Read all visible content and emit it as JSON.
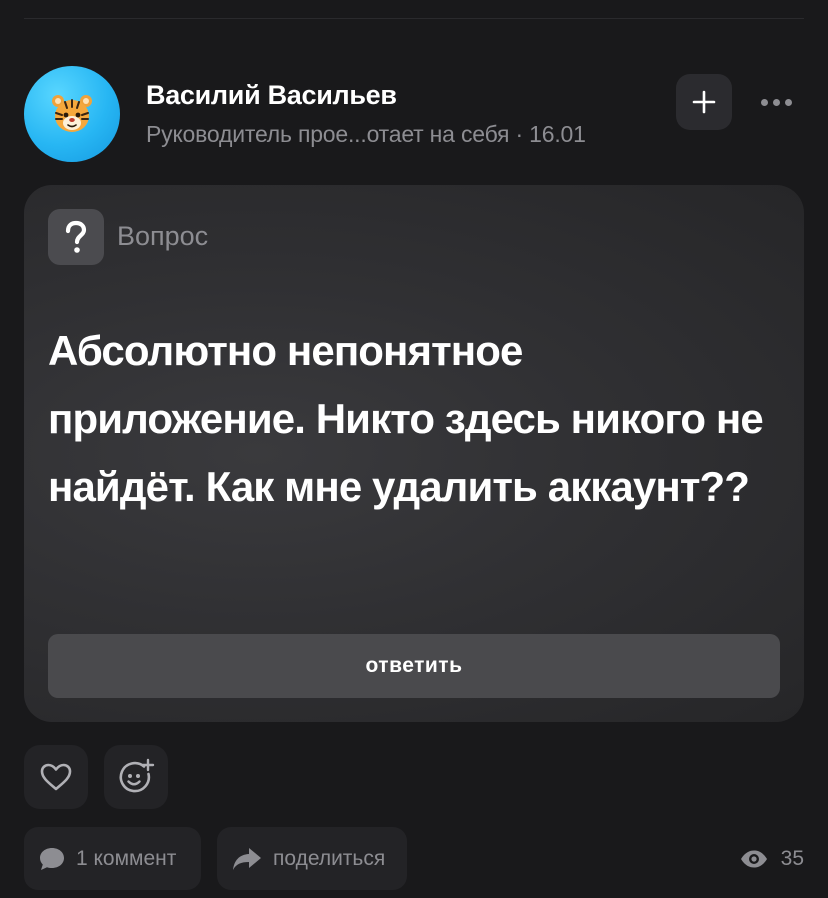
{
  "post": {
    "author_name": "Василий Васильев",
    "author_meta": "Руководитель прое...отает на себя · 16.01",
    "follow_symbol": "+",
    "question_mark": "?",
    "question_label": "Вопрос",
    "question_text": "Абсолютно непонятное приложение. Никто здесь никого не найдёт. Как мне удалить аккаунт??",
    "answer_label": "ответить",
    "comments_label": "1 коммент",
    "share_label": "поделиться",
    "views_count": "35"
  },
  "icons": {
    "avatar": "tiger-face-icon",
    "follow": "plus-icon",
    "more": "ellipsis-icon",
    "question": "question-mark-icon",
    "like": "heart-icon",
    "react": "emoji-add-icon",
    "comment": "comment-bubble-icon",
    "share": "share-arrow-icon",
    "views": "eye-icon"
  },
  "colors": {
    "background": "#19191b",
    "card": "#303033",
    "button": "#4a4a4d",
    "muted_text": "#8d8d92",
    "avatar_bg": "#27b6f3"
  }
}
